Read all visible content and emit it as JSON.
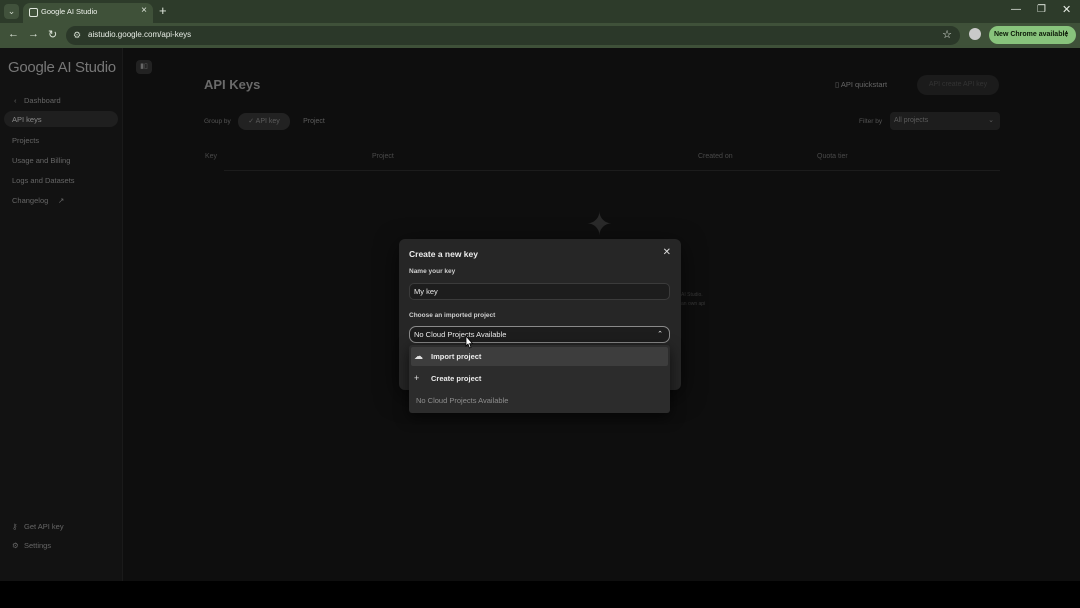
{
  "browser": {
    "tab_title": "Google AI Studio",
    "url": "aistudio.google.com/api-keys",
    "new_chrome_label": "New Chrome available",
    "colors": {
      "tab_strip": "#2d3b2a",
      "toolbar": "#3f5139",
      "update_button": "#88c37c"
    }
  },
  "sidebar": {
    "logo": "Google AI Studio",
    "back_label": "Dashboard",
    "items": [
      "API keys",
      "Projects",
      "Usage and Billing",
      "Logs and Datasets",
      "Changelog"
    ],
    "bottom_items": [
      "Get API key",
      "Settings"
    ]
  },
  "main": {
    "title": "API Keys",
    "quickstart": "API quickstart",
    "create_button": "API create API key",
    "group_by_label": "Group by",
    "group_by_options": [
      "API key",
      "Project"
    ],
    "filter_label": "Filter by",
    "filter_value": "All projects",
    "columns": [
      "Key",
      "Project",
      "Created on",
      "Quota tier"
    ],
    "faint_lines": [
      "AI Studio.",
      "an own api"
    ]
  },
  "dialog": {
    "title": "Create a new key",
    "name_label": "Name your key",
    "name_value": "My key",
    "project_label": "Choose an imported project",
    "project_selected": "No Cloud Projects Available",
    "menu": {
      "items": [
        {
          "icon": "cloud-upload-icon",
          "label": "Import project"
        },
        {
          "icon": "plus-icon",
          "label": "Create project"
        }
      ],
      "empty_label": "No Cloud Projects Available"
    }
  }
}
